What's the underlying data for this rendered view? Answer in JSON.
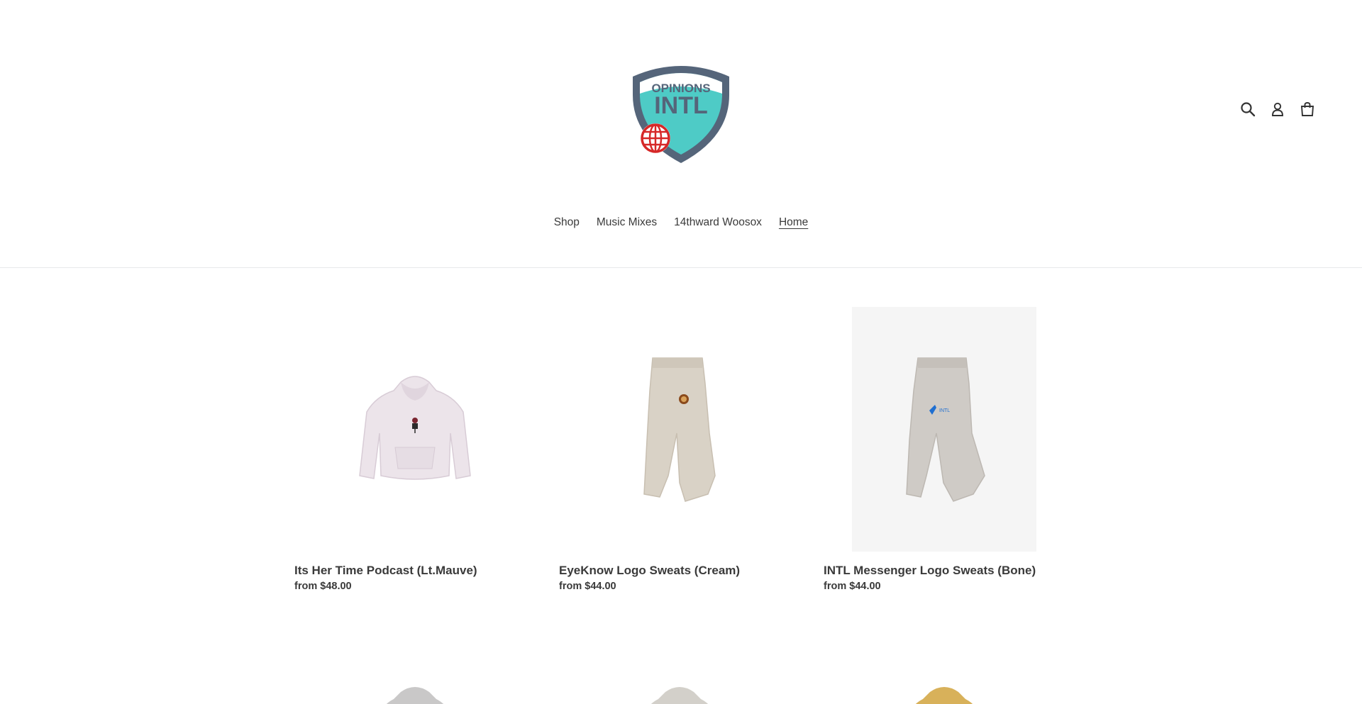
{
  "brand": {
    "logo_top_text": "OPINIONS",
    "logo_main_text": "INTL",
    "colors": {
      "shield_outer": "#55657a",
      "shield_inner": "#4ecbc6",
      "globe": "#d62828"
    }
  },
  "header": {
    "icons": [
      "search-icon",
      "account-icon",
      "cart-icon"
    ]
  },
  "nav": {
    "items": [
      {
        "label": "Shop"
      },
      {
        "label": "Music Mixes"
      },
      {
        "label": "14thward Woosox"
      },
      {
        "label": "Home",
        "active": true
      }
    ]
  },
  "products": [
    {
      "title": "Its Her Time Podcast (Lt.Mauve)",
      "price": "from $48.00",
      "kind": "hoodie",
      "color": "#ece4ea"
    },
    {
      "title": "EyeKnow Logo Sweats (Cream)",
      "price": "from $44.00",
      "kind": "pants",
      "color": "#d9d2c6"
    },
    {
      "title": "INTL Messenger Logo Sweats (Bone)",
      "price": "from $44.00",
      "kind": "pants",
      "color": "#cfcbc6",
      "bg": "#f5f5f5"
    }
  ],
  "products_row2_colors": [
    "#c9c8c8",
    "#d3d0ca",
    "#d8b15a"
  ]
}
